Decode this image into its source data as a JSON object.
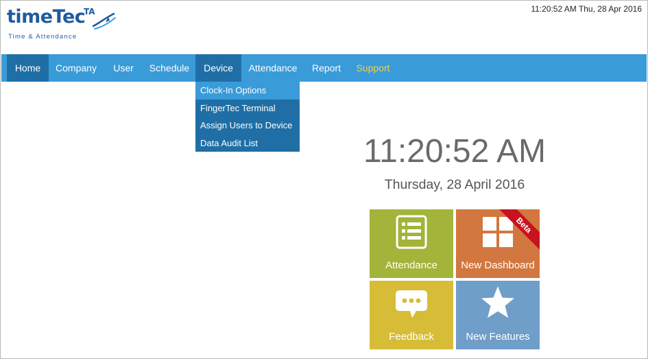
{
  "header": {
    "logo": {
      "word_time": "time",
      "word_tec": "Tec",
      "word_ta": "TA",
      "tagline": "Time & Attendance"
    },
    "datetime": "11:20:52 AM Thu, 28 Apr 2016"
  },
  "nav": {
    "items": [
      {
        "label": "Home"
      },
      {
        "label": "Company"
      },
      {
        "label": "User"
      },
      {
        "label": "Schedule"
      },
      {
        "label": "Device"
      },
      {
        "label": "Attendance"
      },
      {
        "label": "Report"
      },
      {
        "label": "Support"
      }
    ],
    "active": "Home",
    "open": "Device"
  },
  "dropdown": {
    "items": [
      {
        "label": "Clock-In Options"
      },
      {
        "label": "FingerTec Terminal"
      },
      {
        "label": "Assign Users to Device"
      },
      {
        "label": "Data Audit List"
      }
    ]
  },
  "clock": {
    "time": "11:20:52 AM",
    "date": "Thursday, 28 April 2016"
  },
  "tiles": [
    {
      "label": "Attendance",
      "icon": "list-icon",
      "color": "#a2b43a"
    },
    {
      "label": "New Dashboard",
      "icon": "dashboard-grid-icon",
      "color": "#d2773f",
      "badge": "Beta"
    },
    {
      "label": "Feedback",
      "icon": "chat-bubble-icon",
      "color": "#d7bd37"
    },
    {
      "label": "New Features",
      "icon": "star-icon",
      "color": "#6f9ec9"
    }
  ],
  "colors": {
    "nav_bg": "#3a9bd9",
    "nav_active": "#1f6fa6",
    "support_text": "#f4d03f",
    "beta_ribbon": "#c8121f"
  }
}
